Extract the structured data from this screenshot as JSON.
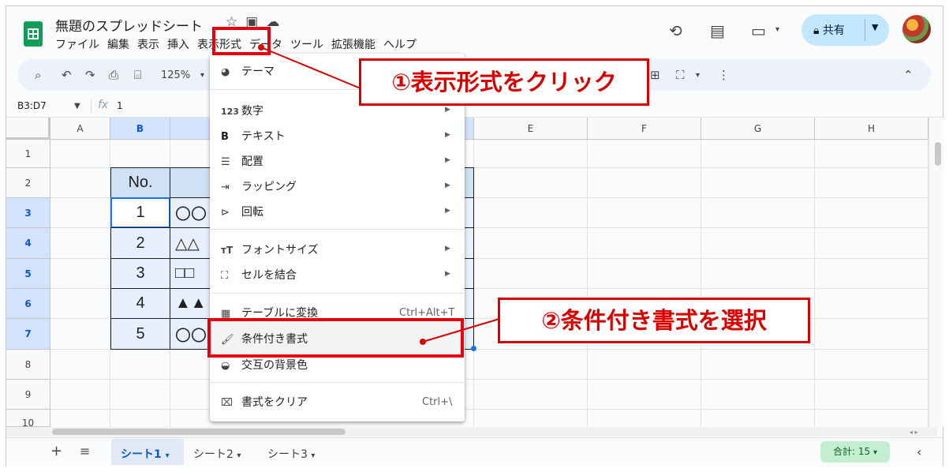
{
  "doc": {
    "title": "無題のスプレッドシート"
  },
  "menubar": [
    "ファイル",
    "編集",
    "表示",
    "挿入",
    "表示形式",
    "データ",
    "ツール",
    "拡張機能",
    "ヘルプ"
  ],
  "share": {
    "label": "共有"
  },
  "toolbar": {
    "zoom": "125%"
  },
  "formula": {
    "namebox": "B3:D7",
    "value": "1"
  },
  "columns": [
    "A",
    "B",
    "",
    "",
    "E",
    "F",
    "G",
    "H"
  ],
  "rows": [
    "1",
    "2",
    "3",
    "4",
    "5",
    "6",
    "7",
    "8",
    "9",
    "10"
  ],
  "table": {
    "header": "No.",
    "numbers": [
      "1",
      "2",
      "3",
      "4",
      "5"
    ],
    "names": [
      "〇〇",
      "△△",
      "□□",
      "▲▲",
      "〇〇"
    ]
  },
  "format_menu": {
    "items": [
      {
        "label": "テーマ",
        "icon": "palette-icon"
      },
      {
        "label": "数字",
        "icon": "123-icon"
      },
      {
        "label": "テキスト",
        "icon": "bold-icon"
      },
      {
        "label": "配置",
        "icon": "align-icon"
      },
      {
        "label": "ラッピング",
        "icon": "wrap-icon"
      },
      {
        "label": "回転",
        "icon": "rotate-icon"
      },
      {
        "label": "フォントサイズ",
        "icon": "font-size-icon"
      },
      {
        "label": "セルを結合",
        "icon": "merge-icon"
      },
      {
        "label": "テーブルに変換",
        "icon": "table-icon",
        "shortcut": "Ctrl+Alt+T"
      },
      {
        "label": "条件付き書式",
        "icon": "paint-roller-icon"
      },
      {
        "label": "交互の背景色",
        "icon": "fill-icon"
      },
      {
        "label": "書式をクリア",
        "icon": "clear-format-icon",
        "shortcut": "Ctrl+\\"
      }
    ]
  },
  "annotations": {
    "step1": "①表示形式をクリック",
    "step2": "②条件付き書式を選択",
    "color": "#d90000"
  },
  "sheets": [
    "シート1",
    "シート2",
    "シート3"
  ],
  "status": {
    "sum": "合計: 15"
  }
}
